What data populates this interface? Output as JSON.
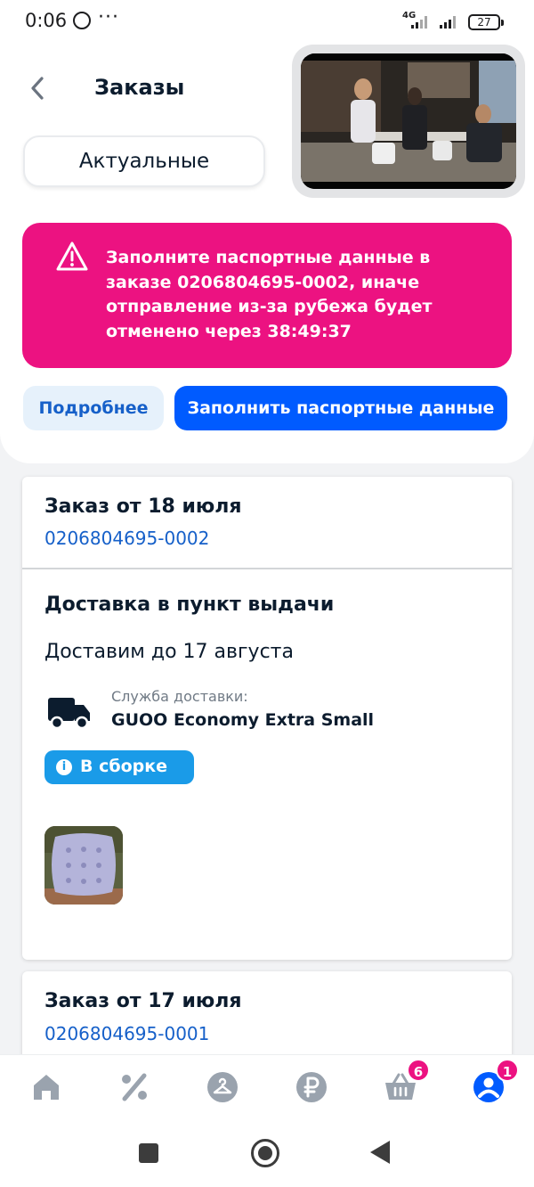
{
  "status_bar": {
    "time": "0:06",
    "dots": "···",
    "network": "4G",
    "battery": "27"
  },
  "header": {
    "title": "Заказы"
  },
  "tabs": {
    "active": "Актуальные"
  },
  "alert": {
    "text": "Заполните паспортные данные в заказе 0206804695-0002, иначе отправление из-за рубежа будет отменено через 38:49:37",
    "color": "#ec1281"
  },
  "actions": {
    "more_label": "Подробнее",
    "fill_label": "Заполнить паспортные данные"
  },
  "orders": [
    {
      "title": "Заказ от 18 июля",
      "number": "0206804695-0002",
      "delivery_title": "Доставка в пункт выдачи",
      "delivery_date": "Доставим до 17 августа",
      "service_label": "Служба доставки:",
      "service_name": "GUOO Economy Extra Small",
      "status": "В сборке",
      "status_color": "#1a9be8",
      "thumbnail_icon": "seat-cushion-photo"
    },
    {
      "title": "Заказ от 17 июля",
      "number": "0206804695-0001"
    }
  ],
  "bottom_nav": {
    "items": [
      {
        "icon": "home-icon"
      },
      {
        "icon": "percent-icon"
      },
      {
        "icon": "hanger-icon"
      },
      {
        "icon": "ruble-icon"
      },
      {
        "icon": "basket-icon",
        "badge": "6"
      },
      {
        "icon": "profile-icon",
        "badge": "1",
        "active": true
      }
    ],
    "accent": "#005bff",
    "inactive_color": "#9aa3ae"
  },
  "colors": {
    "primary": "#005bff",
    "link": "#1660c9",
    "badge": "#ec1281"
  }
}
